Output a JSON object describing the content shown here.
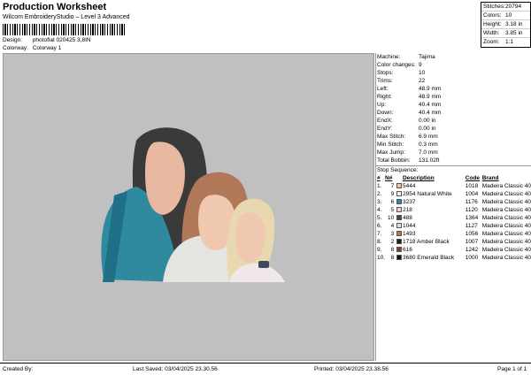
{
  "header": {
    "title": "Production Worksheet",
    "subtitle": "Wilcom EmbroideryStudio – Level 3 Advanced",
    "design_label": "Design:",
    "design_value": "photoflat 020425 3,8IN",
    "colorway_label": "Colorway:",
    "colorway_value": "Colorway 1"
  },
  "stats": [
    {
      "k": "Stitches:",
      "v": "20794"
    },
    {
      "k": "Colors:",
      "v": "10"
    },
    {
      "k": "Height:",
      "v": "3.18 in"
    },
    {
      "k": "Width:",
      "v": "3.85 in"
    },
    {
      "k": "Zoom:",
      "v": "1:1"
    }
  ],
  "machine_info": [
    {
      "k": "Machine:",
      "v": "Tajima"
    },
    {
      "k": "Color changes:",
      "v": "9"
    },
    {
      "k": "Stops:",
      "v": "10"
    },
    {
      "k": "Trims:",
      "v": "22"
    },
    {
      "k": "Left:",
      "v": "48.9 mm"
    },
    {
      "k": "Right:",
      "v": "48.9 mm"
    },
    {
      "k": "Up:",
      "v": "40.4 mm"
    },
    {
      "k": "Down:",
      "v": "40.4 mm"
    },
    {
      "k": "EndX:",
      "v": "0.00 in"
    },
    {
      "k": "EndY:",
      "v": "0.00 in"
    },
    {
      "k": "Max Stitch:",
      "v": "6.9 mm"
    },
    {
      "k": "Min Stitch:",
      "v": "0.3 mm"
    },
    {
      "k": "Max Jump:",
      "v": "7.0 mm"
    },
    {
      "k": "Total Bobbin:",
      "v": "131.02ft"
    }
  ],
  "sequence": {
    "title": "Stop Sequence:",
    "headers": [
      "#",
      "N#",
      "",
      "Description",
      "Code",
      "Brand"
    ],
    "rows": [
      {
        "num": "1.",
        "n": "7",
        "color": "#f0c0a8",
        "id": "5444",
        "desc": "",
        "code": "1018",
        "brand": "Madeira Classic 40"
      },
      {
        "num": "2.",
        "n": "9",
        "color": "#f4f4f4",
        "id": "2954",
        "desc": "Natural White",
        "code": "1004",
        "brand": "Madeira Classic 40"
      },
      {
        "num": "3.",
        "n": "6",
        "color": "#2f8aa0",
        "id": "3237",
        "desc": "",
        "code": "1176",
        "brand": "Madeira Classic 40"
      },
      {
        "num": "4.",
        "n": "5",
        "color": "#f0d0d8",
        "id": "218",
        "desc": "",
        "code": "1120",
        "brand": "Madeira Classic 40"
      },
      {
        "num": "5.",
        "n": "10",
        "color": "#404a58",
        "id": "488",
        "desc": "",
        "code": "1364",
        "brand": "Madeira Classic 40"
      },
      {
        "num": "6.",
        "n": "4",
        "color": "#f0dcd0",
        "id": "1044",
        "desc": "",
        "code": "1127",
        "brand": "Madeira Classic 40"
      },
      {
        "num": "7.",
        "n": "3",
        "color": "#b07858",
        "id": "1493",
        "desc": "",
        "code": "1056",
        "brand": "Madeira Classic 40"
      },
      {
        "num": "8.",
        "n": "2",
        "color": "#202020",
        "id": "1718",
        "desc": "Amber Black",
        "code": "1007",
        "brand": "Madeira Classic 40"
      },
      {
        "num": "9.",
        "n": "8",
        "color": "#804030",
        "id": "616",
        "desc": "",
        "code": "1242",
        "brand": "Madeira Classic 40"
      },
      {
        "num": "10.",
        "n": "8",
        "color": "#101010",
        "id": "3680",
        "desc": "Emerald Black",
        "code": "1000",
        "brand": "Madeira Classic 40"
      }
    ]
  },
  "footer": {
    "created": "Created By:",
    "saved": "Last Saved: 03/04/2025 23.30.56",
    "printed": "Printed: 03/04/2025 23.38.56",
    "page": "Page 1 of 1"
  }
}
